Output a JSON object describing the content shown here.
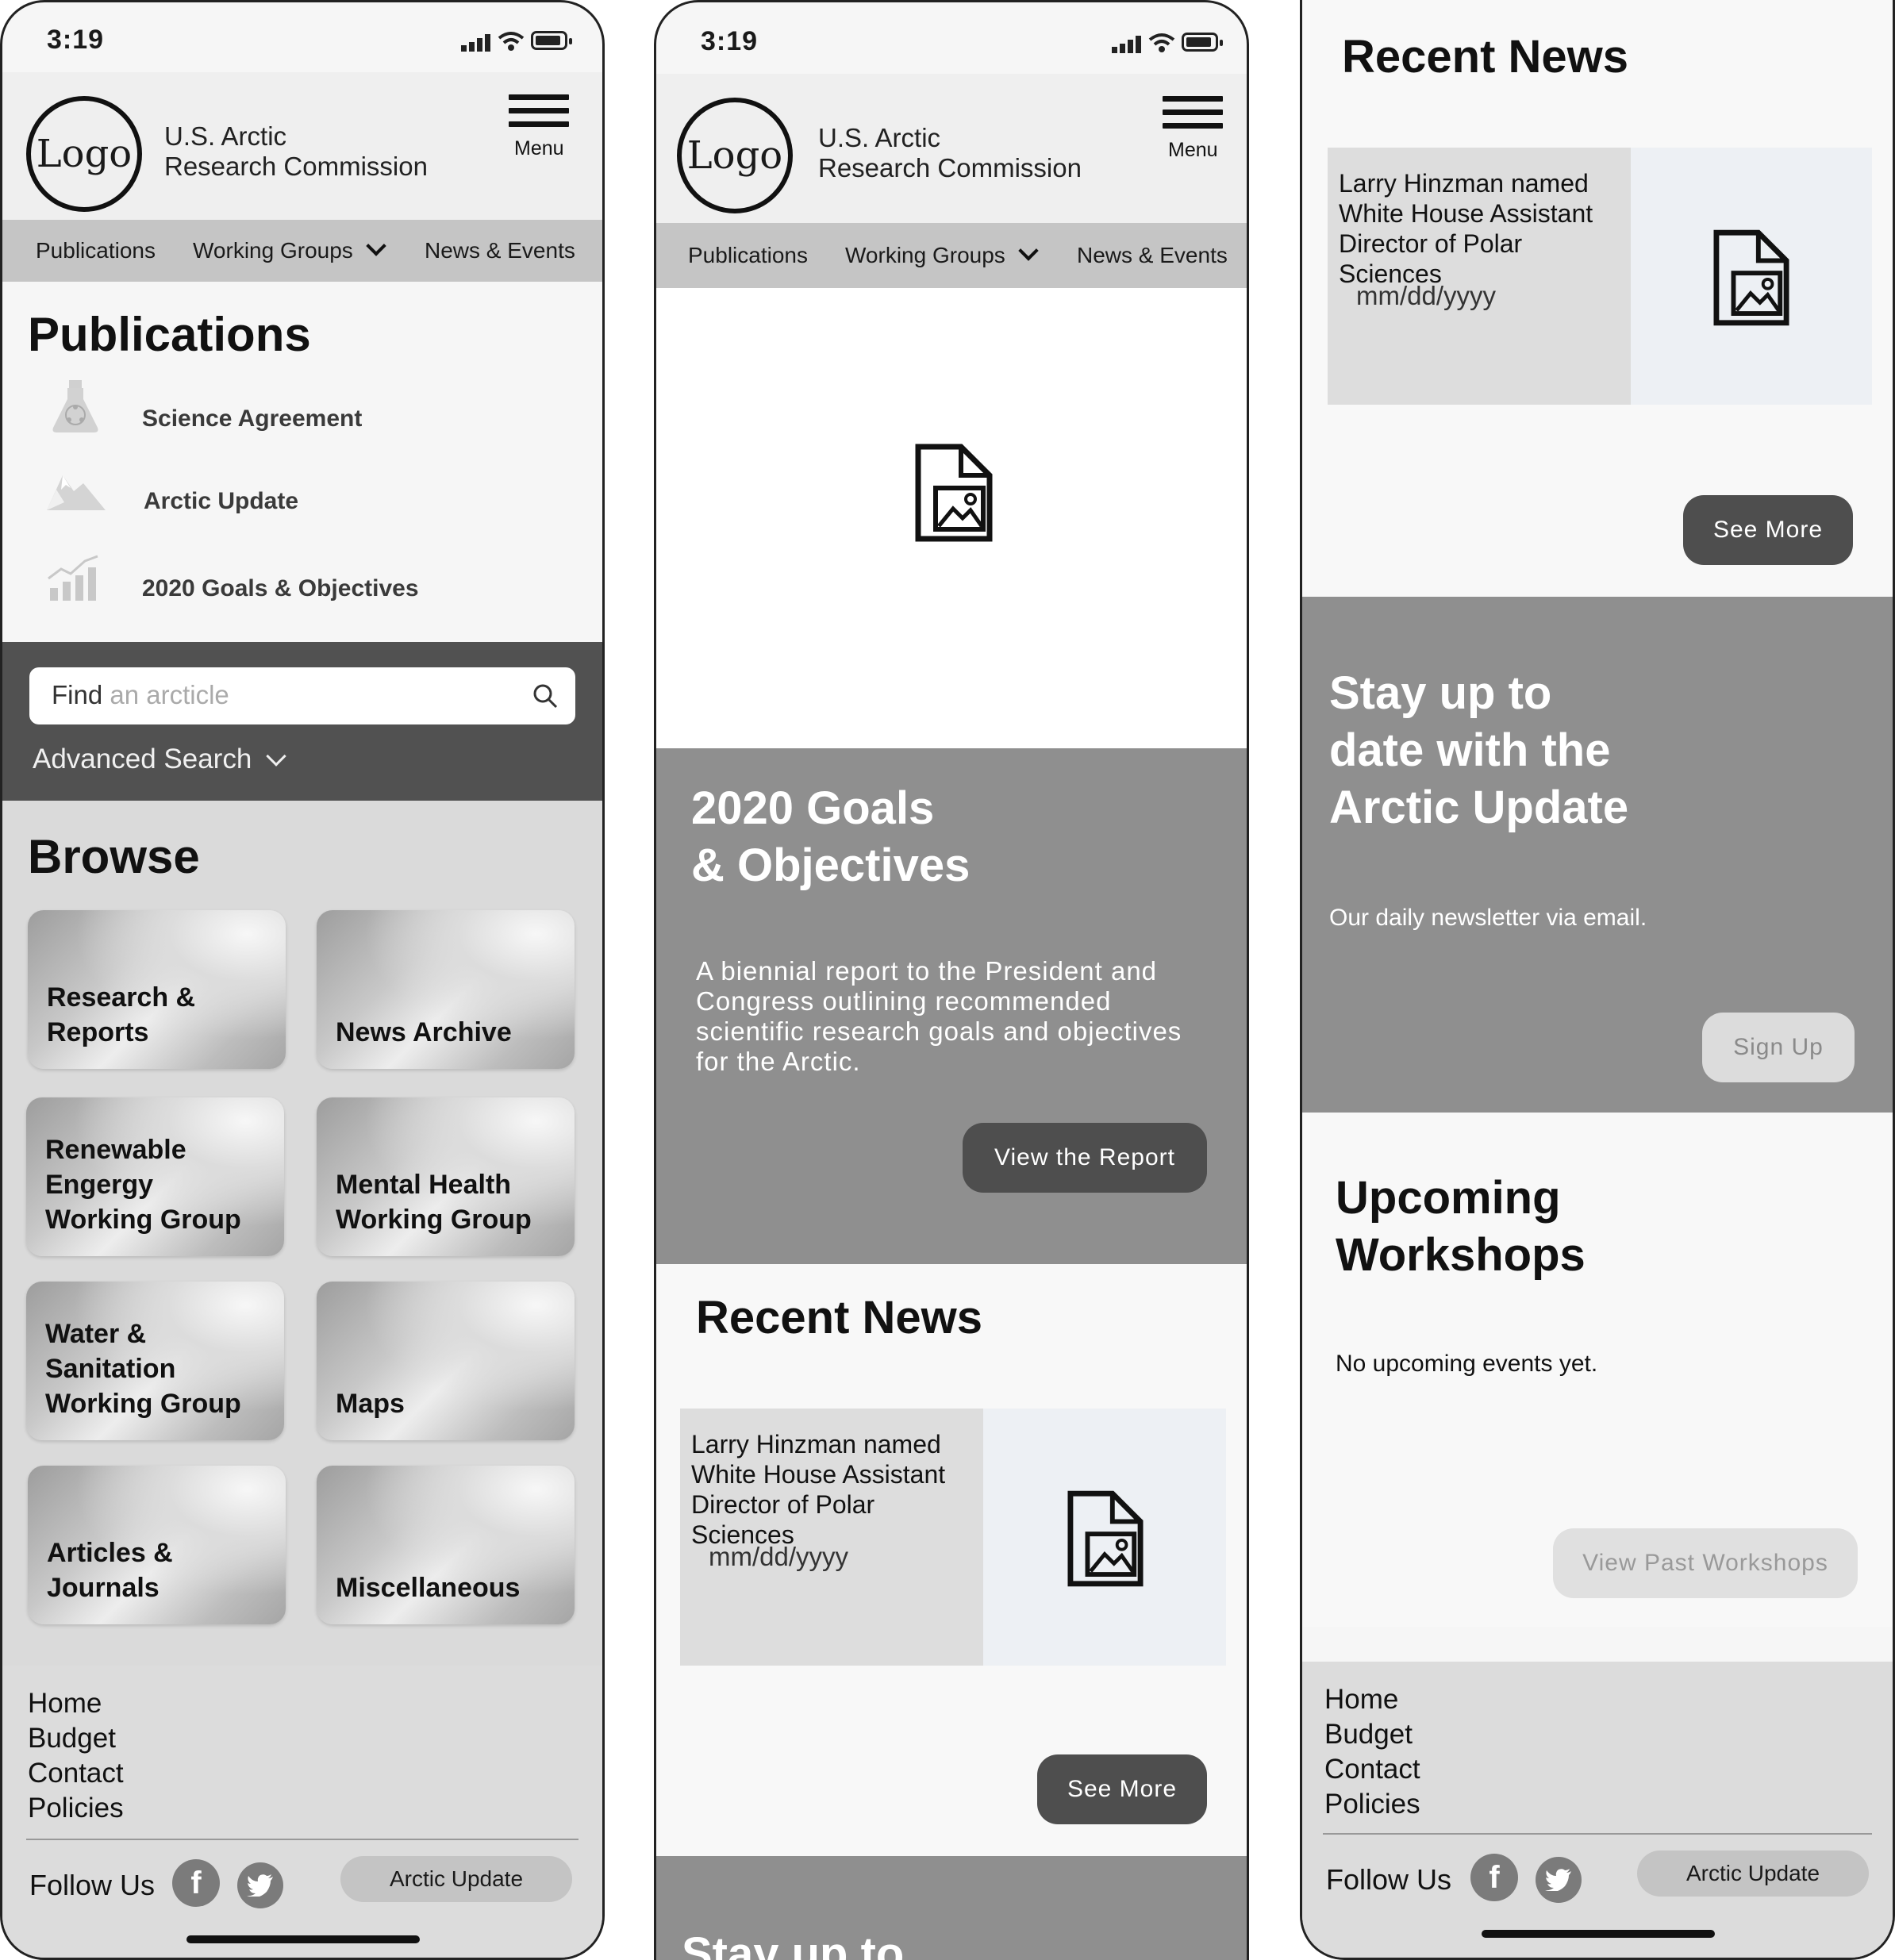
{
  "status": {
    "time": "3:19"
  },
  "header": {
    "logo_text": "Logo",
    "org_name": "U.S. Arctic\nResearch Commission",
    "menu_label": "Menu"
  },
  "nav": {
    "items": [
      "Publications",
      "Working Groups",
      "News & Events"
    ]
  },
  "publications": {
    "title": "Publications",
    "items": [
      {
        "label": "Science Agreement",
        "icon": "flask-icon"
      },
      {
        "label": "Arctic Update",
        "icon": "mountain-icon"
      },
      {
        "label": "2020 Goals & Objectives",
        "icon": "bar-chart-icon"
      }
    ]
  },
  "search": {
    "value": "Find",
    "placeholder": " an arcticle",
    "advanced_label": "Advanced Search"
  },
  "browse": {
    "title": "Browse",
    "tiles": [
      "Research &\nReports",
      "News Archive",
      "Renewable\nEngergy\nWorking Group",
      "Mental Health\nWorking Group",
      "Water &\nSanitation\nWorking Group",
      "Maps",
      "Articles &\nJournals",
      "Miscellaneous"
    ]
  },
  "footer": {
    "links": [
      "Home",
      "Budget",
      "Contact",
      "Policies"
    ],
    "follow_label": "Follow Us",
    "social": [
      "facebook-icon",
      "twitter-icon"
    ],
    "arctic_update_button": "Arctic Update"
  },
  "goals": {
    "title": "2020  Goals\n& Objectives",
    "description": "A biennial report to the President and Congress outlining recommended scientific research goals and objectives for the Arctic.",
    "button": "View the Report"
  },
  "recent_news": {
    "title": "Recent News",
    "item": {
      "headline": "Larry Hinzman named White House Assistant Director of Polar Sciences",
      "date": "mm/dd/yyyy"
    },
    "button": "See More"
  },
  "newsletter": {
    "title_partial": "Stay up to",
    "title": "Stay up to\ndate with the\nArctic Update",
    "subtitle": "Our daily newsletter via email.",
    "button": "Sign Up"
  },
  "workshops": {
    "title": "Upcoming\nWorkshops",
    "empty_text": "No upcoming events yet.",
    "button": "View Past Workshops"
  },
  "colors": {
    "dark": "#515151",
    "mid_gray": "#8f8f8f",
    "nav_gray": "#c5c5c5",
    "light_bg": "#f6f6f6"
  }
}
